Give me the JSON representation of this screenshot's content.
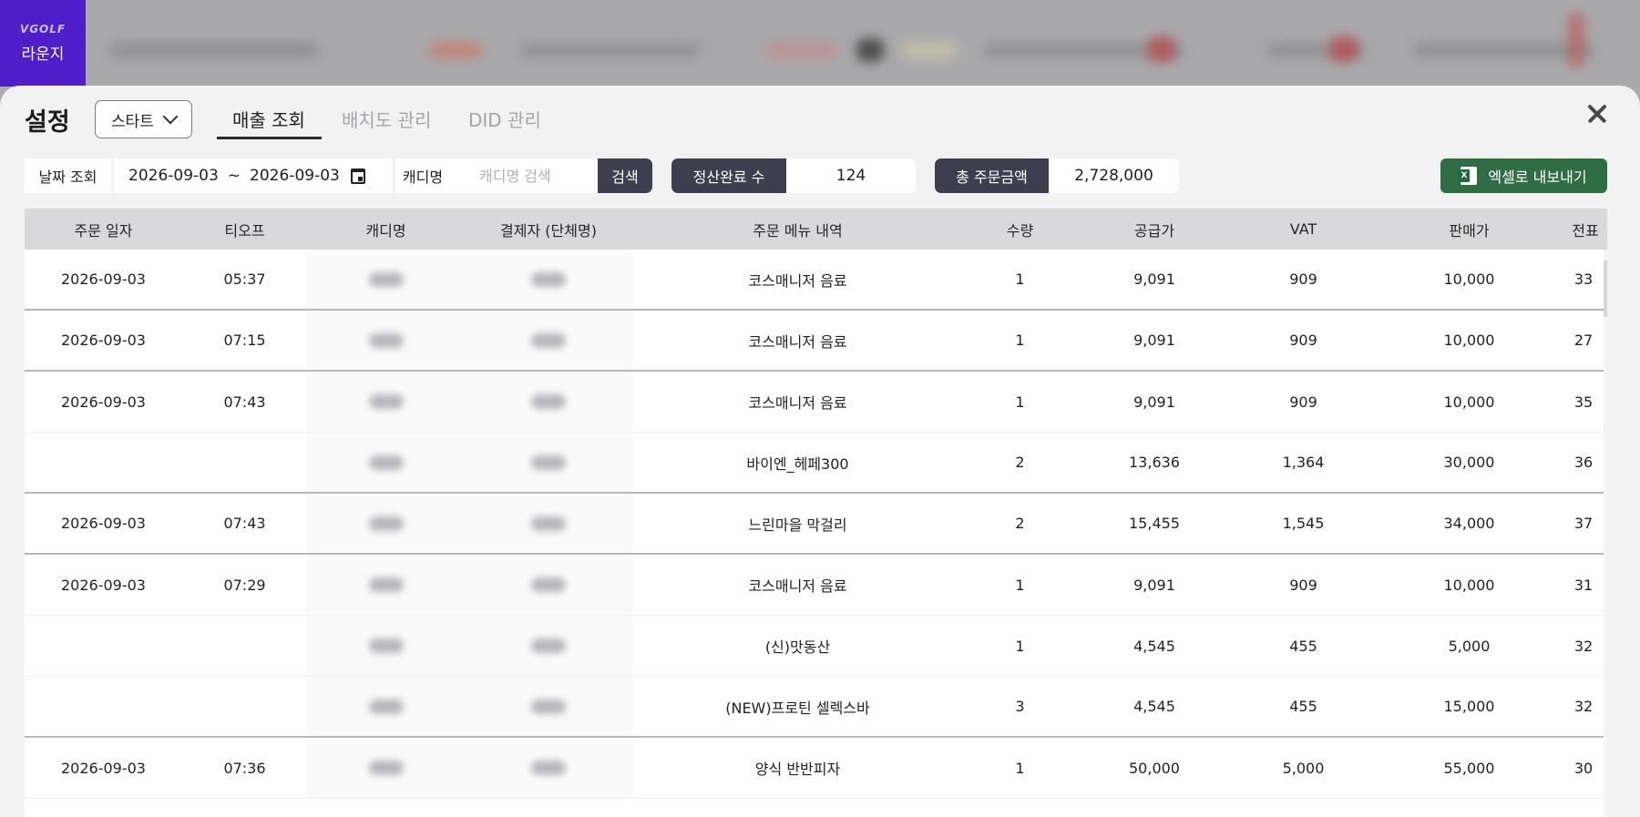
{
  "brand": {
    "logo_text": "VGOLF",
    "name": "라운지"
  },
  "header": {
    "title": "설정",
    "store_select": "스타트",
    "tabs": [
      {
        "label": "매출 조회",
        "active": true
      },
      {
        "label": "배치도 관리",
        "active": false
      },
      {
        "label": "DID 관리",
        "active": false
      }
    ]
  },
  "filters": {
    "date_label": "날짜 조회",
    "date_from": "2026-09-03",
    "date_sep": "~",
    "date_to": "2026-09-03",
    "caddie_label": "캐디명",
    "caddie_placeholder": "캐디명 검색",
    "search_label": "검색",
    "completed_label": "정산완료 수",
    "completed_value": "124",
    "total_label": "총 주문금액",
    "total_value": "2,728,000",
    "export_label": "엑셀로 내보내기"
  },
  "table": {
    "columns": [
      "주문 일자",
      "티오프",
      "캐디명",
      "결제자 (단체명)",
      "주문 메뉴 내역",
      "수량",
      "공급가",
      "VAT",
      "판매가",
      "전표"
    ],
    "rows": [
      {
        "date": "2026-09-03",
        "teeoff": "05:37",
        "menu": "코스매니저 음료",
        "qty": "1",
        "supply": "9,091",
        "vat": "909",
        "price": "10,000",
        "slip": "33",
        "group_end": true
      },
      {
        "date": "2026-09-03",
        "teeoff": "07:15",
        "menu": "코스매니저 음료",
        "qty": "1",
        "supply": "9,091",
        "vat": "909",
        "price": "10,000",
        "slip": "27",
        "group_end": true
      },
      {
        "date": "2026-09-03",
        "teeoff": "07:43",
        "menu": "코스매니저 음료",
        "qty": "1",
        "supply": "9,091",
        "vat": "909",
        "price": "10,000",
        "slip": "35",
        "group_end": false
      },
      {
        "date": "",
        "teeoff": "",
        "menu": "바이엔_헤페300",
        "qty": "2",
        "supply": "13,636",
        "vat": "1,364",
        "price": "30,000",
        "slip": "36",
        "group_end": true
      },
      {
        "date": "2026-09-03",
        "teeoff": "07:43",
        "menu": "느린마을 막걸리",
        "qty": "2",
        "supply": "15,455",
        "vat": "1,545",
        "price": "34,000",
        "slip": "37",
        "group_end": true
      },
      {
        "date": "2026-09-03",
        "teeoff": "07:29",
        "menu": "코스매니저 음료",
        "qty": "1",
        "supply": "9,091",
        "vat": "909",
        "price": "10,000",
        "slip": "31",
        "group_end": false
      },
      {
        "date": "",
        "teeoff": "",
        "menu": "(신)맛동산",
        "qty": "1",
        "supply": "4,545",
        "vat": "455",
        "price": "5,000",
        "slip": "32",
        "group_end": false
      },
      {
        "date": "",
        "teeoff": "",
        "menu": "(NEW)프로틴 셀렉스바",
        "qty": "3",
        "supply": "4,545",
        "vat": "455",
        "price": "15,000",
        "slip": "32",
        "group_end": true
      },
      {
        "date": "2026-09-03",
        "teeoff": "07:36",
        "menu": "양식 반반피자",
        "qty": "1",
        "supply": "50,000",
        "vat": "5,000",
        "price": "55,000",
        "slip": "30",
        "group_end": false
      }
    ]
  },
  "colors": {
    "brand": "#4f1ec8",
    "accent_dark": "#3e3e4f",
    "excel_green": "#2f6d45",
    "modal_bg": "#f2f2f3",
    "table_header": "#d9d9db"
  },
  "icons": [
    "chevron-down-icon",
    "close-icon",
    "calendar-icon",
    "excel-icon"
  ]
}
